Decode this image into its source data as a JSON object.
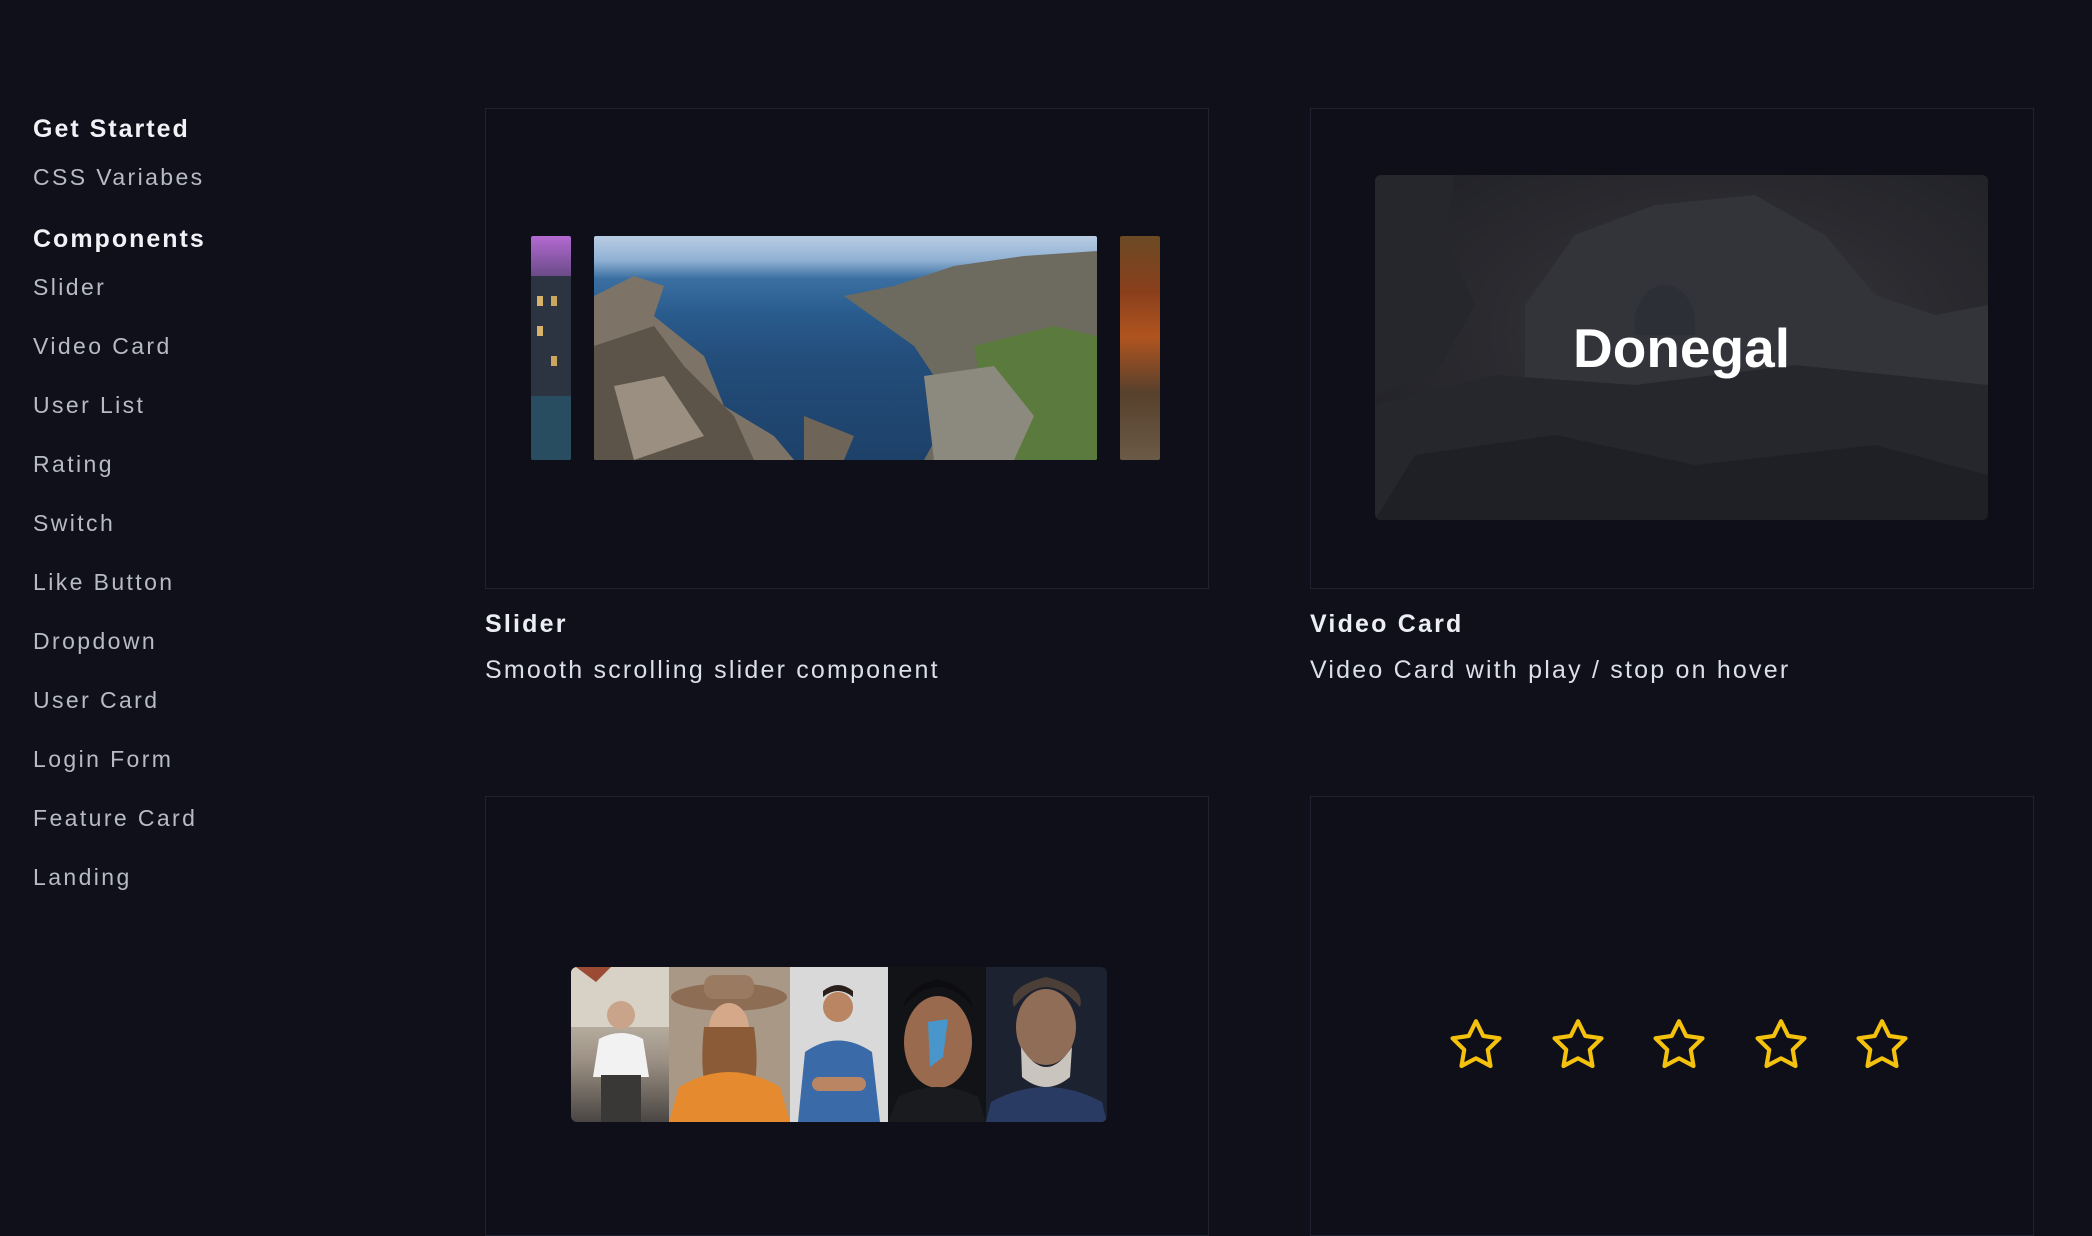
{
  "sidebar": {
    "sections": [
      {
        "title": "Get Started",
        "items": [
          "CSS Variabes"
        ]
      },
      {
        "title": "Components",
        "items": [
          "Slider",
          "Video Card",
          "User List",
          "Rating",
          "Switch",
          "Like Button",
          "Dropdown",
          "User Card",
          "Login Form",
          "Feature Card",
          "Landing"
        ]
      }
    ]
  },
  "cards": {
    "slider": {
      "title": "Slider",
      "description": "Smooth scrolling slider component"
    },
    "video": {
      "title": "Video Card",
      "description": "Video Card with play / stop on hover",
      "overlay_text": "Donegal"
    }
  },
  "rating": {
    "stars": 5,
    "filled": 0,
    "star_color": "#f4c20d"
  },
  "user_list": {
    "avatars": 5
  },
  "colors": {
    "background": "#0f1019",
    "card_border": "#1f2230",
    "accent_star": "#f4c20d"
  }
}
